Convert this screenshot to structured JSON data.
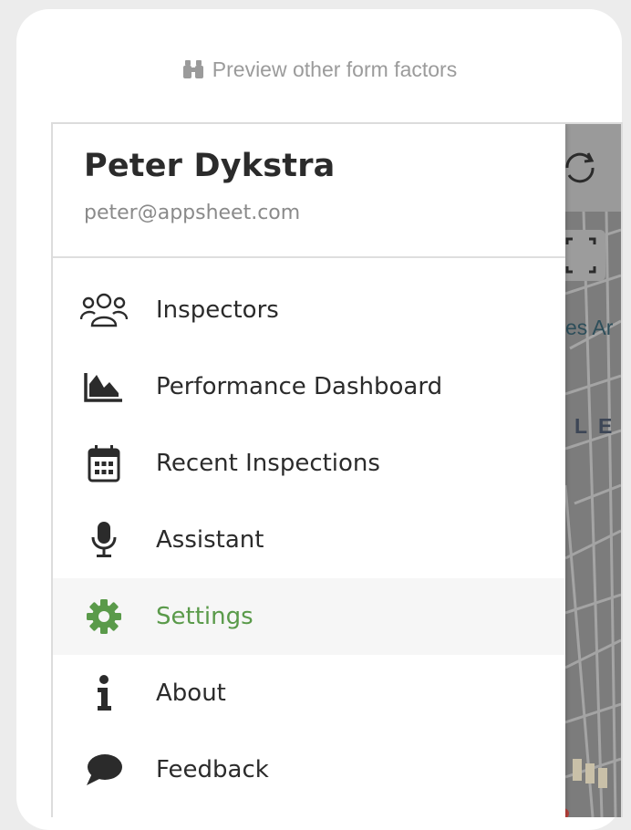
{
  "preview": {
    "label": "Preview other form factors",
    "icon": "binoculars-icon"
  },
  "user": {
    "name": "Peter Dykstra",
    "email": "peter@appsheet.com"
  },
  "menu": {
    "items": [
      {
        "label": "Inspectors",
        "icon": "users-icon",
        "active": false
      },
      {
        "label": "Performance Dashboard",
        "icon": "area-chart-icon",
        "active": false
      },
      {
        "label": "Recent Inspections",
        "icon": "calendar-icon",
        "active": false
      },
      {
        "label": "Assistant",
        "icon": "microphone-icon",
        "active": false
      },
      {
        "label": "Settings",
        "icon": "gear-icon",
        "active": true
      },
      {
        "label": "About",
        "icon": "info-icon",
        "active": false
      },
      {
        "label": "Feedback",
        "icon": "speech-bubble-icon",
        "active": false
      }
    ]
  },
  "map": {
    "label_partial_1": "es Ar",
    "label_partial_2": "L E"
  },
  "colors": {
    "accent": "#5a9a4a",
    "text": "#2b2b2b",
    "muted": "#8a8a8a",
    "active_bg": "#f6f6f6"
  }
}
